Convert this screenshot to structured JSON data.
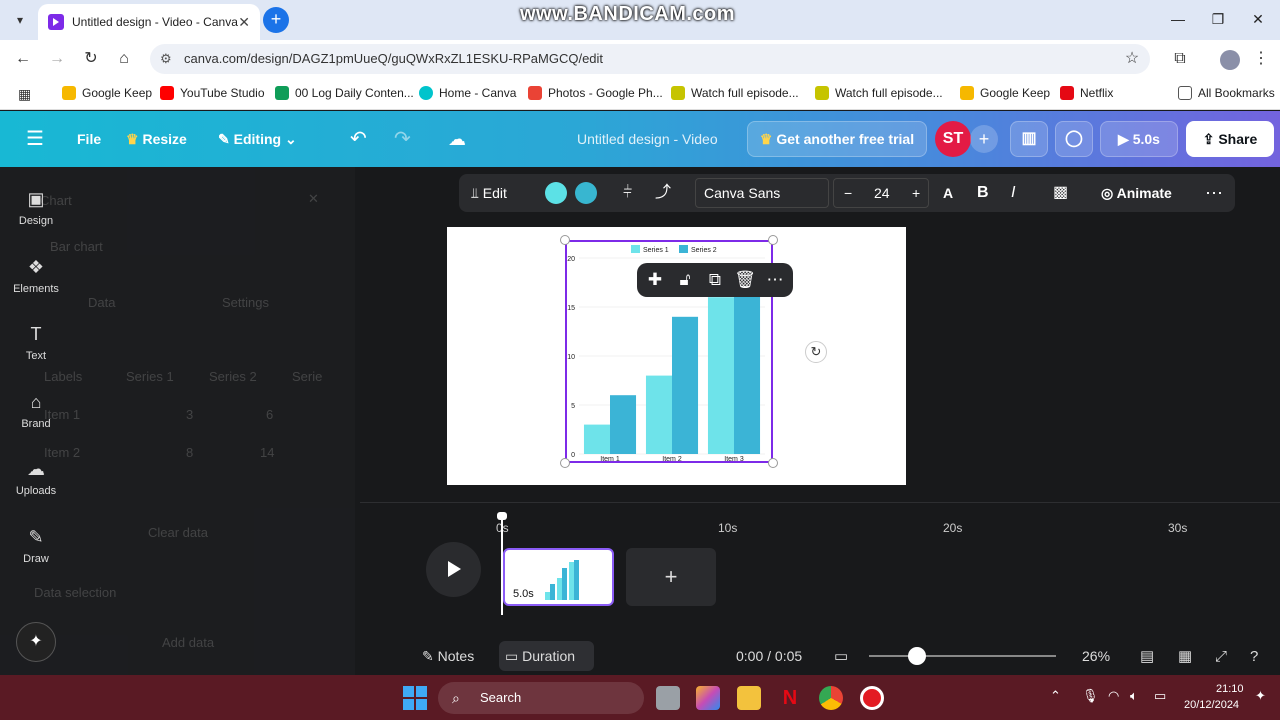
{
  "browser": {
    "tab_title": "Untitled design - Video - Canva",
    "url": "canva.com/design/DAGZ1pmUueQ/guQWxRxZL1ESKU-RPaMGCQ/edit",
    "watermark": "www.BANDICAM.com",
    "bookmarks": [
      {
        "label": "Google Keep",
        "color": "#f6b800"
      },
      {
        "label": "YouTube Studio",
        "color": "#ff0000"
      },
      {
        "label": "00 Log Daily Conten...",
        "color": "#0f9d58"
      },
      {
        "label": "Home - Canva",
        "color": "#00c4cc"
      },
      {
        "label": "Photos - Google Ph...",
        "color": "#ea4335"
      },
      {
        "label": "Watch full episode...",
        "color": "#8bc34a"
      },
      {
        "label": "Watch full episode...",
        "color": "#8bc34a"
      },
      {
        "label": "Google Keep",
        "color": "#f6b800"
      },
      {
        "label": "Netflix",
        "color": "#e50914"
      }
    ],
    "all_bookmarks": "All Bookmarks"
  },
  "canva_bar": {
    "file": "File",
    "resize": "Resize",
    "editing": "Editing",
    "doc_title": "Untitled design - Video",
    "trial": "Get another free trial",
    "avatar": "ST",
    "play_duration": "5.0s",
    "share": "Share"
  },
  "left_rail": [
    {
      "label": "Design",
      "icon": "design-icon"
    },
    {
      "label": "Elements",
      "icon": "elements-icon"
    },
    {
      "label": "Text",
      "icon": "text-icon"
    },
    {
      "label": "Brand",
      "icon": "brand-icon"
    },
    {
      "label": "Uploads",
      "icon": "uploads-icon"
    },
    {
      "label": "Draw",
      "icon": "draw-icon"
    }
  ],
  "side_panel": {
    "title": "Chart",
    "chart_type": "Bar chart",
    "tabs": [
      "Data",
      "Settings"
    ],
    "columns": [
      "Labels",
      "Series 1",
      "Series 2",
      "Serie"
    ],
    "rows": [
      {
        "label": "Item 1",
        "s1": "3",
        "s2": "6"
      },
      {
        "label": "Item 2",
        "s1": "8",
        "s2": "14"
      }
    ],
    "clear_data": "Clear data",
    "data_selection": "Data selection",
    "add_data": "Add data"
  },
  "toolbar": {
    "edit": "Edit",
    "font": "Canva Sans",
    "font_size": "24",
    "animate": "Animate",
    "color1": "#5ce1e6",
    "color2": "#38b6d0"
  },
  "chart_data": {
    "type": "bar",
    "categories": [
      "Item 1",
      "Item 2",
      "Item 3"
    ],
    "series": [
      {
        "name": "Series 1",
        "values": [
          3,
          8,
          16
        ],
        "color": "#6ee3ea"
      },
      {
        "name": "Series 2",
        "values": [
          6,
          14,
          17
        ],
        "color": "#3bb4d6"
      }
    ],
    "ylim": [
      0,
      20
    ],
    "yticks": [
      0,
      5,
      10,
      15,
      20
    ],
    "legend": "top"
  },
  "timeline": {
    "ticks": [
      "0s",
      "10s",
      "20s",
      "30s"
    ],
    "clip_duration": "5.0s"
  },
  "bottom_bar": {
    "notes": "Notes",
    "duration": "Duration",
    "time": "0:00 / 0:05",
    "zoom": "26%"
  },
  "taskbar": {
    "search": "Search",
    "time": "21:10",
    "date": "20/12/2024"
  }
}
